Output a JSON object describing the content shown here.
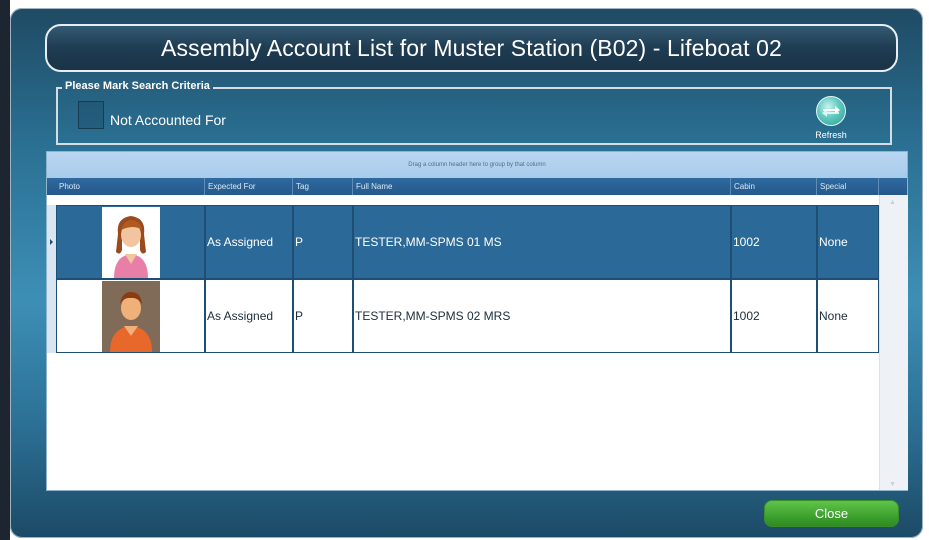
{
  "window": {
    "title": "Assembly Account List for Muster Station (B02) - Lifeboat 02"
  },
  "search_criteria": {
    "legend": "Please Mark Search Criteria",
    "checkbox_label": "Not Accounted For",
    "checkbox_checked": false,
    "refresh_label": "Refresh",
    "refresh_icon": "refresh-icon"
  },
  "grid": {
    "group_panel_text": "Drag a column header here to group by that column",
    "columns": [
      "Photo",
      "Expected For",
      "Tag",
      "Full Name",
      "Cabin",
      "Special"
    ],
    "rows": [
      {
        "photo_icon": "female-avatar-icon",
        "expected_for": "As Assigned",
        "tag": "P",
        "full_name": "TESTER,MM-SPMS 01 MS",
        "cabin": "1002",
        "special": "None",
        "selected": true
      },
      {
        "photo_icon": "male-avatar-icon",
        "expected_for": "As Assigned",
        "tag": "P",
        "full_name": "TESTER,MM-SPMS 02 MRS",
        "cabin": "1002",
        "special": "None",
        "selected": false
      }
    ]
  },
  "footer": {
    "close_label": "Close"
  },
  "colors": {
    "title_bar": "#1e3c52",
    "selected_row": "#2b6a98",
    "header": "#24598b",
    "close_button": "#3ea22e"
  }
}
